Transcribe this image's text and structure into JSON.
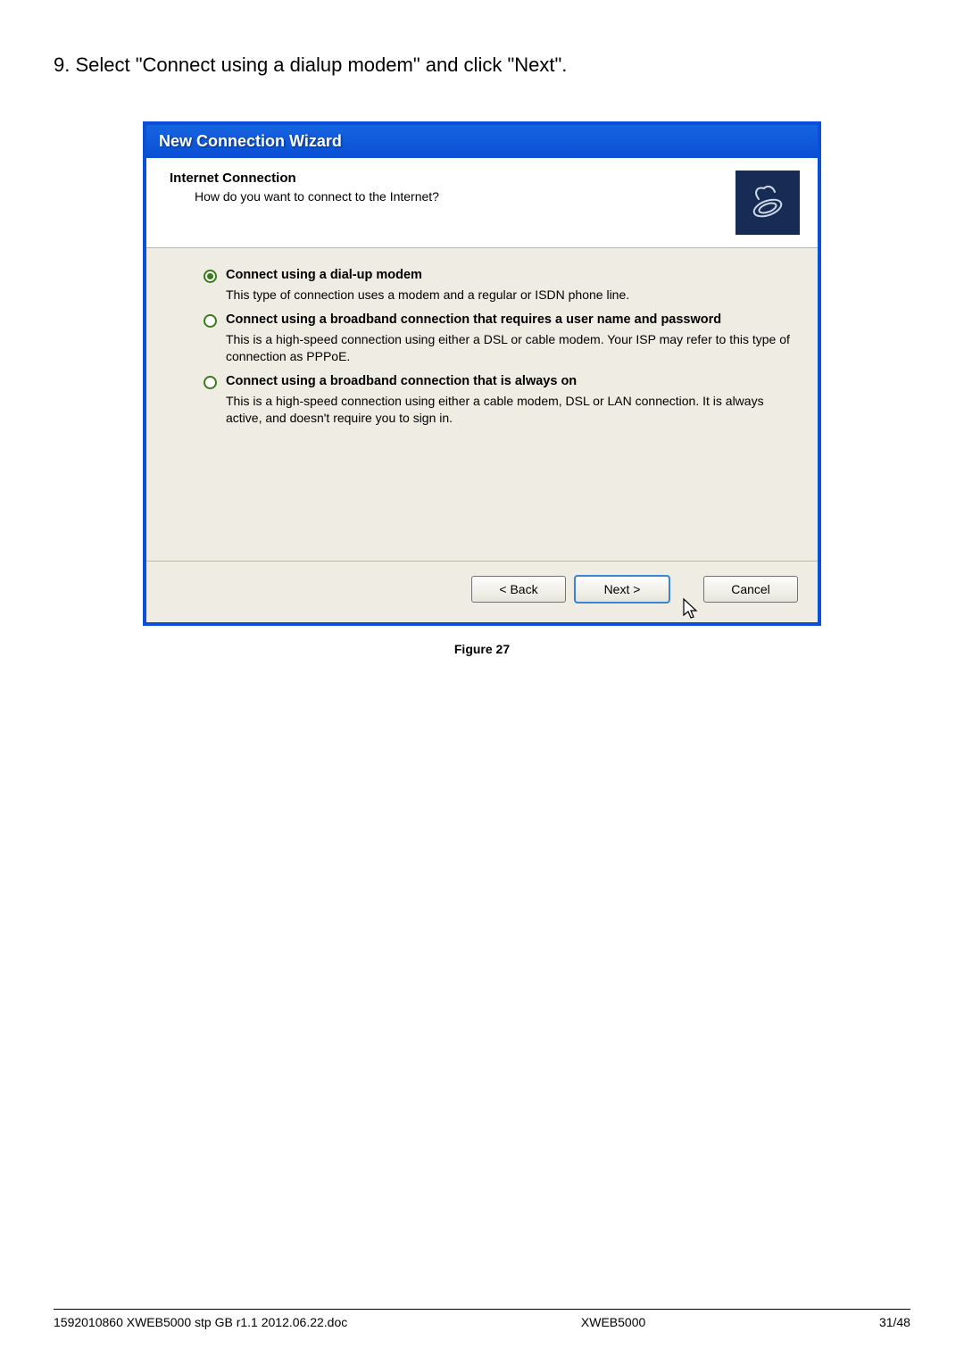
{
  "instruction": "9. Select \"Connect using a dialup modem\" and click \"Next\".",
  "wizard": {
    "title": "New Connection Wizard",
    "header_title": "Internet Connection",
    "header_sub": "How do you want to connect to the Internet?",
    "options": [
      {
        "label": "Connect using a dial-up modem",
        "desc": "This type of connection uses a modem and a regular or ISDN phone line.",
        "selected": true
      },
      {
        "label": "Connect using a broadband connection that requires a user name and password",
        "desc": "This is a high-speed connection using either a DSL or cable modem. Your ISP may refer to this type of connection as PPPoE.",
        "selected": false
      },
      {
        "label": "Connect using a broadband connection that is always on",
        "desc": "This is a high-speed connection using either a cable modem, DSL or LAN connection. It is always active, and doesn't require you to sign in.",
        "selected": false
      }
    ],
    "buttons": {
      "back": "< Back",
      "next": "Next >",
      "cancel": "Cancel"
    }
  },
  "figure_caption": "Figure 27",
  "footer": {
    "left": "1592010860 XWEB5000 stp GB r1.1 2012.06.22.doc",
    "center": "XWEB5000",
    "right": "31/48"
  }
}
